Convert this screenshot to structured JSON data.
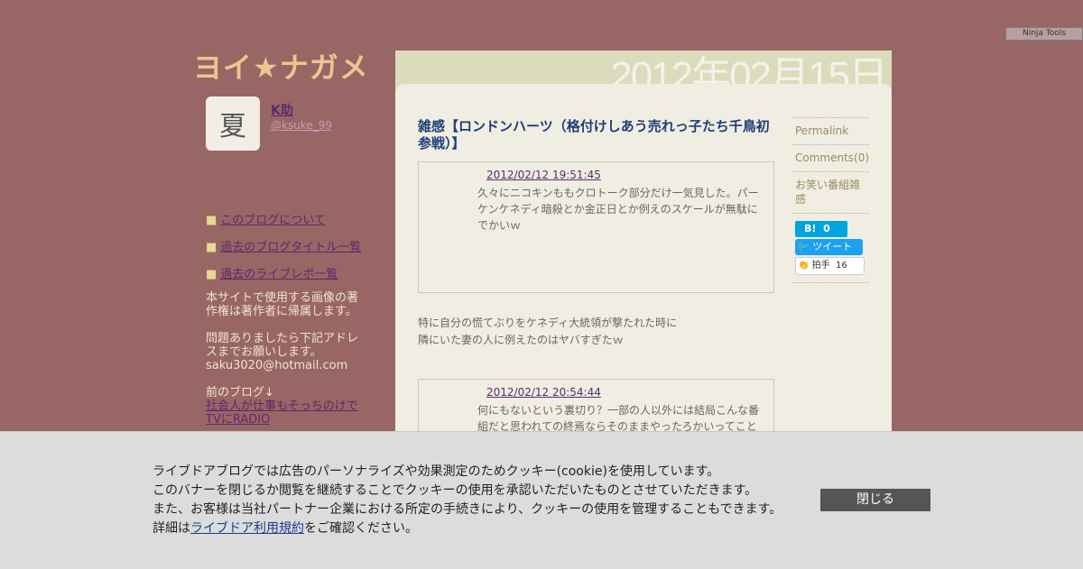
{
  "ninja_tools": "Ninja Tools",
  "blog": {
    "title": "ヨイ★ナガメ",
    "date_header": "2012年02月15日"
  },
  "author": {
    "avatar_char": "夏",
    "name": "K助",
    "handle": "@ksuke_99"
  },
  "sidebar": {
    "links": [
      "このブログについて",
      "過去のブログタイトル一覧",
      "過去のライブレポ一覧"
    ],
    "copyright": "本サイトで使用する画像の著作権は著作者に帰属します。",
    "contact_line1": "問題ありましたら下記アドレスまでお願いします。",
    "contact_email": "saku3020@hotmail.com",
    "prev_blog_label": "前のブログ↓",
    "prev_blog_link": "社会人が仕事もそっちのけでTVにRADIO"
  },
  "post": {
    "title": "雑感【ロンドンハーツ（格付けしあう売れっ子たち千鳥初参戦）】",
    "comments": [
      {
        "date": "2012/02/12 19:51:45",
        "text": "久々にニコキンももクロトーク部分だけ一気見した。パーケンケネディ暗殺とか金正日とか例えのスケールが無駄にでかいｗ"
      },
      {
        "date": "2012/02/12 20:54:44",
        "text": "何にもないという裏切り？一部の人以外には結局こんな番組だと思われての終焉ならそのままやったろかいってこと"
      }
    ],
    "body_line1": "特に自分の慌てぶりをケネディ大統領が撃たれた時に",
    "body_line2": "隣にいた妻の人に例えたのはヤバすぎたｗ"
  },
  "meta": {
    "permalink": "Permalink",
    "comments": "Comments(0)",
    "category": "お笑い番組雑感",
    "hatena_count": "0",
    "tweet": "ツイート",
    "clap": "拍手",
    "clap_count": "16"
  },
  "cookie": {
    "line1": "ライブドアブログでは広告のパーソナライズや効果測定のためクッキー(cookie)を使用しています。",
    "line2": "このバナーを閉じるか閲覧を継続することでクッキーの使用を承認いただいたものとさせていただきます。",
    "line3": "また、お客様は当社パートナー企業における所定の手続きにより、クッキーの使用を管理することもできます。",
    "line4_prefix": "詳細は",
    "line4_link": "ライブドア利用規約",
    "line4_suffix": "をご確認ください。",
    "close_label": "閉じる"
  }
}
